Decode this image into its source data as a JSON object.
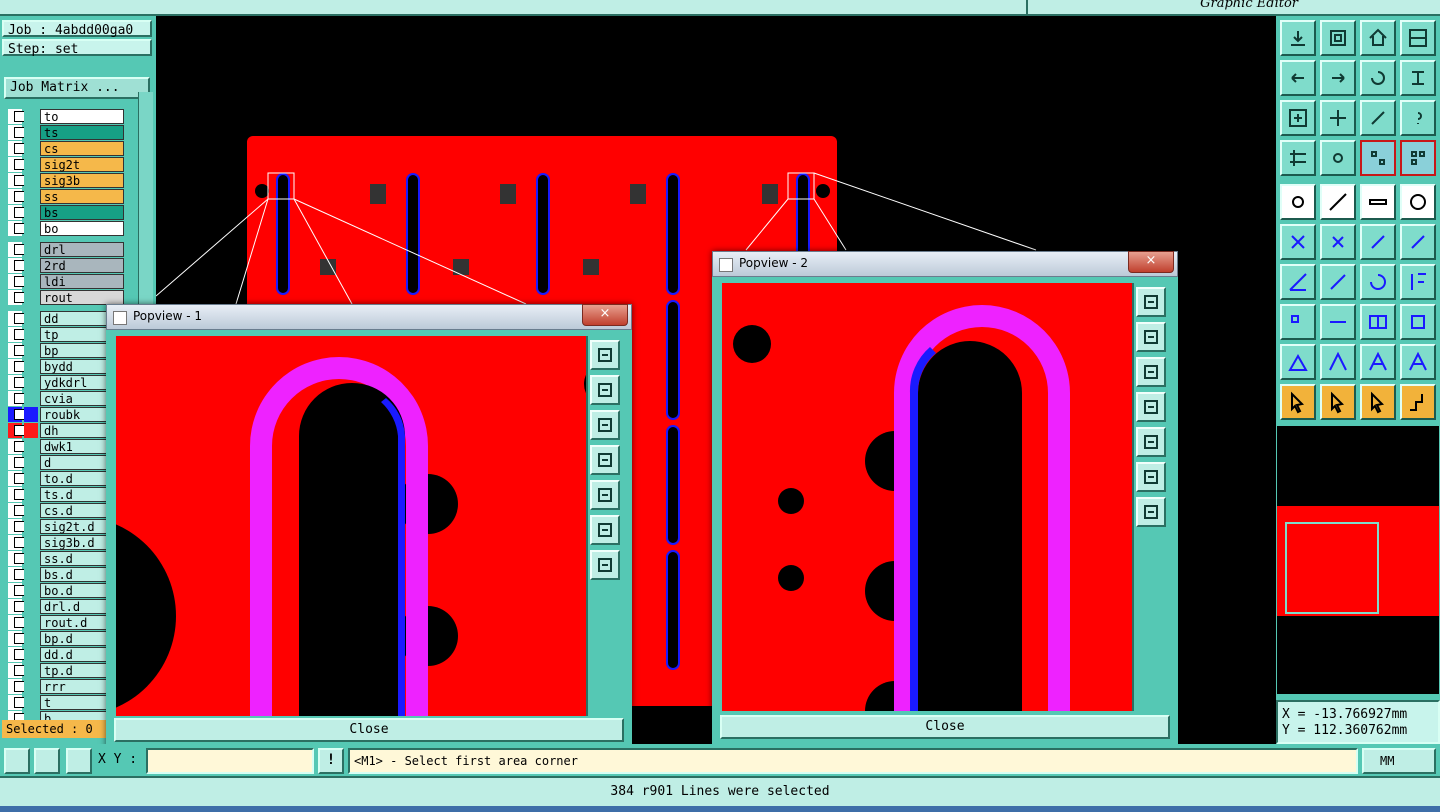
{
  "app": {
    "title": "Graphic Editor"
  },
  "job": {
    "label": "Job : 4abdd00ga0",
    "step": "Step: set",
    "matrix_button": "Job Matrix ..."
  },
  "layers": [
    {
      "name": "to",
      "color": "#ffffff",
      "group": 0
    },
    {
      "name": "ts",
      "color": "#16a085",
      "group": 0
    },
    {
      "name": "cs",
      "color": "#f5b84a",
      "group": 0
    },
    {
      "name": "sig2t",
      "color": "#f5b84a",
      "group": 0
    },
    {
      "name": "sig3b",
      "color": "#f5b84a",
      "group": 0
    },
    {
      "name": "ss",
      "color": "#f5b84a",
      "group": 0
    },
    {
      "name": "bs",
      "color": "#16a085",
      "group": 0
    },
    {
      "name": "bo",
      "color": "#ffffff",
      "group": 0
    },
    {
      "name": "drl",
      "color": "#a9b6bd",
      "group": 1
    },
    {
      "name": "2rd",
      "color": "#a9b6bd",
      "group": 1
    },
    {
      "name": "ldi",
      "color": "#a9b6bd",
      "group": 1
    },
    {
      "name": "rout",
      "color": "#d8d8d8",
      "group": 1
    },
    {
      "name": "dd",
      "color": "#bfeee5",
      "group": 2
    },
    {
      "name": "tp",
      "color": "#bfeee5",
      "group": 2
    },
    {
      "name": "bp",
      "color": "#bfeee5",
      "group": 2
    },
    {
      "name": "bydd",
      "color": "#bfeee5",
      "group": 2
    },
    {
      "name": "ydkdrl",
      "color": "#bfeee5",
      "group": 2
    },
    {
      "name": "cvia",
      "color": "#bfeee5",
      "group": 2
    },
    {
      "name": "roubk",
      "color": "#bfeee5",
      "group": 2,
      "active": "#1a1aff"
    },
    {
      "name": "dh",
      "color": "#bfeee5",
      "group": 2,
      "active": "#ff1a1a"
    },
    {
      "name": "dwk1",
      "color": "#bfeee5",
      "group": 2
    },
    {
      "name": "d",
      "color": "#bfeee5",
      "group": 2
    },
    {
      "name": "to.d",
      "color": "#bfeee5",
      "group": 2
    },
    {
      "name": "ts.d",
      "color": "#bfeee5",
      "group": 2
    },
    {
      "name": "cs.d",
      "color": "#bfeee5",
      "group": 2
    },
    {
      "name": "sig2t.d",
      "color": "#bfeee5",
      "group": 2
    },
    {
      "name": "sig3b.d",
      "color": "#bfeee5",
      "group": 2
    },
    {
      "name": "ss.d",
      "color": "#bfeee5",
      "group": 2
    },
    {
      "name": "bs.d",
      "color": "#bfeee5",
      "group": 2
    },
    {
      "name": "bo.d",
      "color": "#bfeee5",
      "group": 2
    },
    {
      "name": "drl.d",
      "color": "#bfeee5",
      "group": 2
    },
    {
      "name": "rout.d",
      "color": "#bfeee5",
      "group": 2
    },
    {
      "name": "bp.d",
      "color": "#bfeee5",
      "group": 2
    },
    {
      "name": "dd.d",
      "color": "#bfeee5",
      "group": 2
    },
    {
      "name": "tp.d",
      "color": "#bfeee5",
      "group": 2
    },
    {
      "name": "rrr",
      "color": "#bfeee5",
      "group": 2
    },
    {
      "name": "t",
      "color": "#bfeee5",
      "group": 2
    },
    {
      "name": "b",
      "color": "#bfeee5",
      "group": 2
    }
  ],
  "selected": {
    "label": "Selected : 0"
  },
  "coords": {
    "x": "X = -13.766927mm",
    "y": "Y = 112.360762mm"
  },
  "command": {
    "xy_label": "X Y :",
    "xy_value": "",
    "prompt": "<M1> - Select first area corner",
    "units": "MM"
  },
  "status": {
    "message": "384 r901 Lines were selected"
  },
  "popview1": {
    "title": "Popview - 1",
    "close": "Close",
    "close_icon": "×"
  },
  "popview2": {
    "title": "Popview - 2",
    "close": "Close",
    "close_icon": "×"
  },
  "toolbar_icons": [
    "open-job-icon",
    "save-job-icon",
    "home-icon",
    "window-icon",
    "zoom-left-icon",
    "zoom-right-icon",
    "undo-zoom-icon",
    "redraw-icon",
    "fit-icon",
    "center-icon",
    "zoom-1to2-icon",
    "help-icon",
    "settings-icon",
    "snap-icon",
    "layers-toggle-icon",
    "layers-grid-icon",
    "pad-icon",
    "line-icon",
    "ruler-icon",
    "circle-icon",
    "connect-icon",
    "delete-point-icon",
    "move-point-icon",
    "add-point-icon",
    "slope-icon",
    "diagonal-icon",
    "rotate-icon",
    "flip-icon",
    "select-pad-icon",
    "measure-line-icon",
    "dimension-icon",
    "group-icon",
    "triangle-icon",
    "triangle-up-icon",
    "triangle-a-icon",
    "triangle-b-icon",
    "pointer-icon",
    "pointer-box-icon",
    "pointer-octagon-icon",
    "route-icon"
  ],
  "colors": {
    "board": "#ff0000",
    "pad": "#000000",
    "trace": "#ee22ff",
    "edge": "#1a1aff",
    "panel": "#55c8b4"
  }
}
